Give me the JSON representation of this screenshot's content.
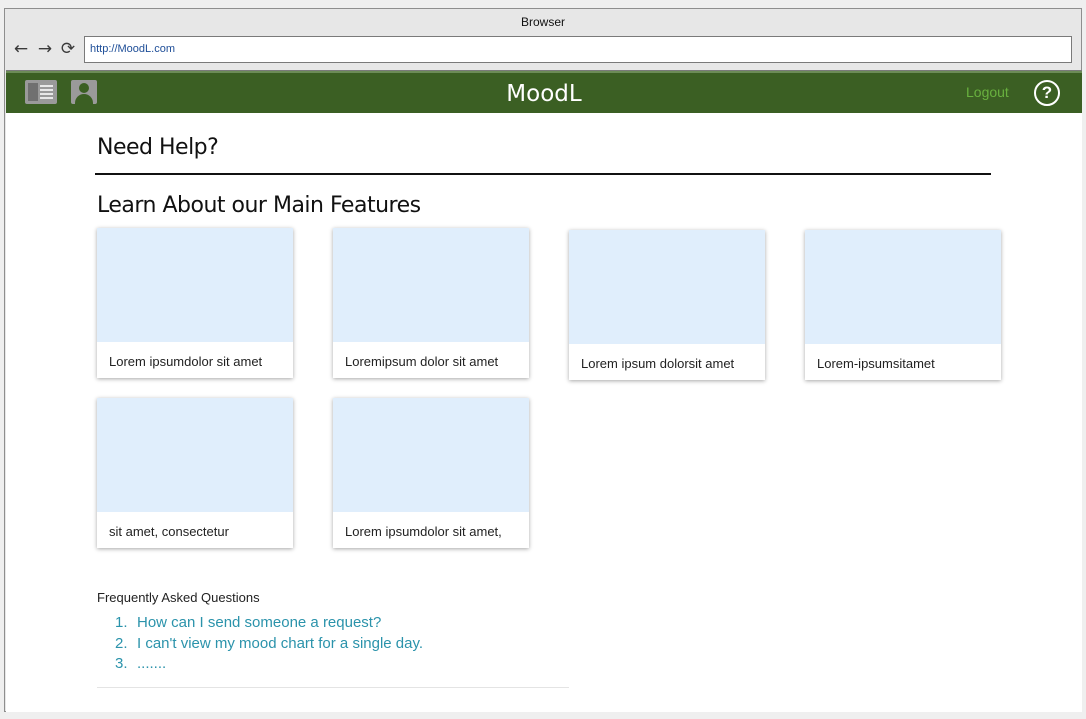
{
  "browser": {
    "title": "Browser",
    "url": "http://MoodL.com",
    "back_icon": "←",
    "forward_icon": "→",
    "reload_icon": "⟳"
  },
  "appbar": {
    "brand": "MoodL",
    "logout": "Logout",
    "help_icon": "?",
    "background_color": "#3b5f23",
    "logout_color": "#69b13f"
  },
  "help": {
    "title": "Need Help?",
    "features_title": "Learn About our Main Features",
    "cards": [
      {
        "caption": "Lorem ipsumdolor sit amet"
      },
      {
        "caption": "Loremipsum dolor sit amet"
      },
      {
        "caption": "Lorem ipsum dolorsit amet"
      },
      {
        "caption": "Lorem-ipsumsitamet"
      },
      {
        "caption": "sit amet, consectetur"
      },
      {
        "caption": "Lorem ipsumdolor sit amet,"
      }
    ],
    "faq_title": "Frequently Asked Questions",
    "faq": [
      {
        "num": "1.",
        "text": "How can I send someone a request?"
      },
      {
        "num": "2.",
        "text": "I can't view my mood chart for a single day."
      },
      {
        "num": "3.",
        "text": "......."
      }
    ],
    "link_color": "#2b93ab"
  }
}
